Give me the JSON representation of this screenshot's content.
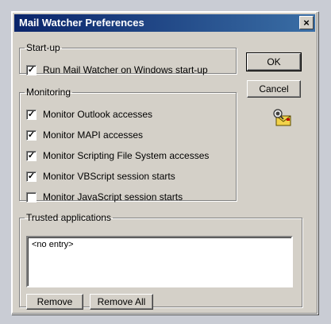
{
  "window": {
    "title": "Mail Watcher Preferences",
    "close_glyph": "×"
  },
  "startup": {
    "legend": "Start-up",
    "items": [
      {
        "label": "Run Mail Watcher on Windows start-up",
        "checked": true
      }
    ]
  },
  "monitoring": {
    "legend": "Monitoring",
    "items": [
      {
        "label": "Monitor Outlook accesses",
        "checked": true
      },
      {
        "label": "Monitor MAPI accesses",
        "checked": true
      },
      {
        "label": "Monitor Scripting File System accesses",
        "checked": true
      },
      {
        "label": "Monitor VBScript session starts",
        "checked": true
      },
      {
        "label": "Monitor JavaScript session starts",
        "checked": false
      }
    ]
  },
  "trusted": {
    "legend": "Trusted applications",
    "entries": [
      "<no entry>"
    ],
    "remove_label": "Remove",
    "remove_all_label": "Remove All"
  },
  "buttons": {
    "ok_label": "OK",
    "cancel_label": "Cancel"
  },
  "icons": {
    "app_icon": "mail-watcher-icon"
  },
  "colors": {
    "titlebar_start": "#0a246a",
    "titlebar_end": "#3a6ea5",
    "face": "#d4d0c8"
  }
}
